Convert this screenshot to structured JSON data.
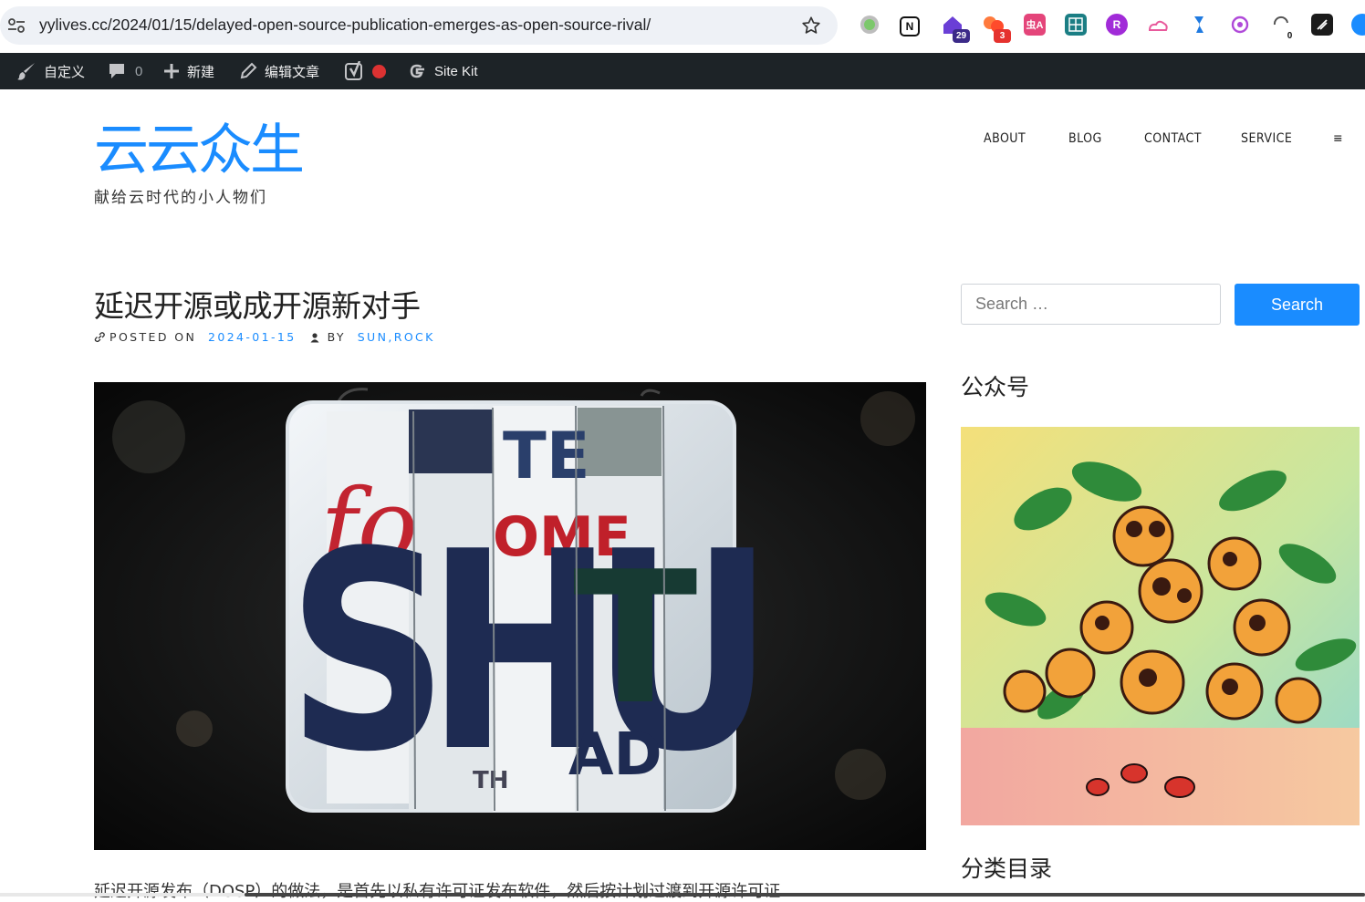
{
  "browser": {
    "url": "yylives.cc/2024/01/15/delayed-open-source-publication-emerges-as-open-source-rival/",
    "extensions": [
      {
        "name": "green-dot-extension-icon"
      },
      {
        "name": "notion-extension-icon",
        "glyph": "N"
      },
      {
        "name": "home-extension-icon",
        "badge": "29"
      },
      {
        "name": "puzzle-extension-icon",
        "badge": "3"
      },
      {
        "name": "translate-extension-icon",
        "glyph": "虫A"
      },
      {
        "name": "grid-extension-icon"
      },
      {
        "name": "purple-r-extension-icon",
        "glyph": "R"
      },
      {
        "name": "weather-extension-icon"
      },
      {
        "name": "blue-bookmark-extension-icon"
      },
      {
        "name": "openai-extension-icon"
      },
      {
        "name": "sync-extension-icon",
        "badge": "0"
      },
      {
        "name": "dark-tile-extension-icon"
      },
      {
        "name": "edge-extension-icon"
      }
    ]
  },
  "admin_bar": {
    "customize": "自定义",
    "comments_count": "0",
    "new": "新建",
    "edit": "编辑文章",
    "site_kit": "Site Kit"
  },
  "site": {
    "title": "云云众生",
    "tagline": "献给云时代的小人物们"
  },
  "nav": {
    "items": [
      "ABOUT",
      "BLOG",
      "CONTACT",
      "SERVICE"
    ],
    "menu_toggle": "≡"
  },
  "post": {
    "title": "延迟开源或成开源新对手",
    "posted_on_label": "POSTED ON",
    "date": "2024-01-15",
    "by_label": "BY",
    "author_1": "SUN",
    "author_sep": ", ",
    "author_2": "ROCK",
    "excerpt": "延迟开源发布（DOSP）的做法，是首先以私有许可证发布软件，然后按计划过渡到开源许可证"
  },
  "sidebar": {
    "search_placeholder": "Search …",
    "search_button": "Search",
    "widget_wechat_title": "公众号",
    "widget_categories_title": "分类目录"
  },
  "colors": {
    "accent": "#1a8cff",
    "admin_bar": "#1d2327"
  }
}
